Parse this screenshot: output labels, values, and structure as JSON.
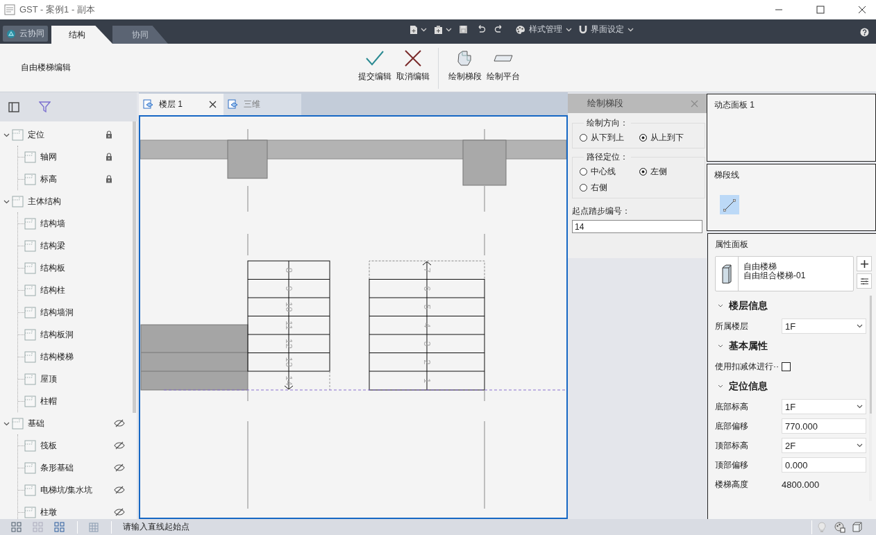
{
  "window": {
    "title": "GST - 案例1 - 副本"
  },
  "cloud_button": {
    "label": "云协同"
  },
  "ribbon_tabs": [
    {
      "label": "结构",
      "selected": true
    },
    {
      "label": "协同",
      "selected": false
    }
  ],
  "quick_toolbar": {
    "style_menu": "样式管理",
    "ui_menu": "界面设定"
  },
  "ribbon": {
    "mode_label": "自由楼梯编辑",
    "groups": [
      [
        {
          "kind": "submit",
          "label": "提交编辑"
        },
        {
          "kind": "cancel",
          "label": "取消编辑"
        }
      ],
      [
        {
          "kind": "run",
          "label": "绘制梯段"
        },
        {
          "kind": "landing",
          "label": "绘制平台"
        }
      ]
    ]
  },
  "tree": [
    {
      "label": "定位",
      "expanded": true,
      "locked": true,
      "hidden": false,
      "children": [
        {
          "label": "轴网",
          "locked": true,
          "hidden": false
        },
        {
          "label": "标高",
          "locked": true,
          "hidden": false
        }
      ]
    },
    {
      "label": "主体结构",
      "expanded": true,
      "locked": false,
      "hidden": false,
      "children": [
        {
          "label": "结构墙",
          "locked": false,
          "hidden": false
        },
        {
          "label": "结构梁",
          "locked": false,
          "hidden": false
        },
        {
          "label": "结构板",
          "locked": false,
          "hidden": false
        },
        {
          "label": "结构柱",
          "locked": false,
          "hidden": false
        },
        {
          "label": "结构墙洞",
          "locked": false,
          "hidden": false
        },
        {
          "label": "结构板洞",
          "locked": false,
          "hidden": false
        },
        {
          "label": "结构楼梯",
          "locked": false,
          "hidden": false
        },
        {
          "label": "屋顶",
          "locked": false,
          "hidden": false
        },
        {
          "label": "柱帽",
          "locked": false,
          "hidden": false
        }
      ]
    },
    {
      "label": "基础",
      "expanded": true,
      "locked": false,
      "hidden": true,
      "children": [
        {
          "label": "筏板",
          "locked": false,
          "hidden": true
        },
        {
          "label": "条形基础",
          "locked": false,
          "hidden": true
        },
        {
          "label": "电梯坑/集水坑",
          "locked": false,
          "hidden": true
        },
        {
          "label": "柱墩",
          "locked": false,
          "hidden": true
        }
      ]
    }
  ],
  "view_tabs": [
    {
      "label": "楼层 1",
      "selected": true,
      "closable": true
    },
    {
      "label": "三维",
      "selected": false,
      "closable": false
    }
  ],
  "drawing": {
    "steps_down": [
      "8",
      "9",
      "10",
      "11",
      "12",
      "13",
      "14"
    ],
    "steps_up": [
      "7",
      "6",
      "5",
      "4",
      "3",
      "2",
      "1"
    ]
  },
  "draw_dialog": {
    "title": "绘制梯段",
    "groups": [
      {
        "legend": "绘制方向：",
        "options": [
          {
            "label": "从下到上",
            "selected": false
          },
          {
            "label": "从上到下",
            "selected": true
          }
        ]
      },
      {
        "legend": "路径定位：",
        "options": [
          {
            "label": "中心线",
            "selected": false
          },
          {
            "label": "左侧",
            "selected": true
          },
          {
            "label": "右侧",
            "selected": false
          }
        ]
      }
    ],
    "start_field": {
      "label": "起点踏步编号：",
      "value": "14"
    }
  },
  "dynamic_panel": {
    "title": "动态面板 1"
  },
  "segment_panel": {
    "title": "梯段线",
    "line_tool": {
      "selected": true
    }
  },
  "properties": {
    "title": "属性面板",
    "type": {
      "name": "自由楼梯",
      "variant": "自由组合楼梯-01"
    },
    "rows": [
      {
        "kind": "section",
        "label": "楼层信息",
        "expanded": true
      },
      {
        "kind": "select",
        "label": "所属楼层",
        "value": "1F"
      },
      {
        "kind": "section",
        "label": "基本属性",
        "expanded": true
      },
      {
        "kind": "checkbox",
        "label": "使用扣减体进行··",
        "checked": false
      },
      {
        "kind": "section",
        "label": "定位信息",
        "expanded": true
      },
      {
        "kind": "select",
        "label": "底部标高",
        "value": "1F"
      },
      {
        "kind": "input",
        "label": "底部偏移",
        "value": "770.000"
      },
      {
        "kind": "select",
        "label": "顶部标高",
        "value": "2F"
      },
      {
        "kind": "input",
        "label": "顶部偏移",
        "value": "0.000"
      },
      {
        "kind": "readonly",
        "label": "楼梯高度",
        "value": "4800.000"
      }
    ]
  },
  "status_bar": {
    "prompt": "请输入直线起始点"
  }
}
